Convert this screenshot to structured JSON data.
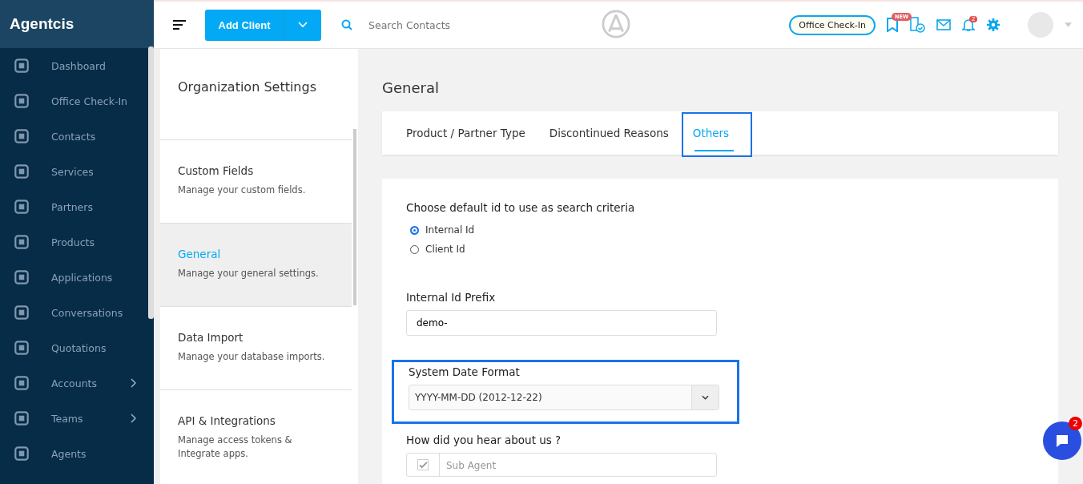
{
  "brand": "Agentcis",
  "sidebar": {
    "items": [
      {
        "label": "Dashboard",
        "has_submenu": false
      },
      {
        "label": "Office Check-In",
        "has_submenu": false
      },
      {
        "label": "Contacts",
        "has_submenu": false
      },
      {
        "label": "Services",
        "has_submenu": false
      },
      {
        "label": "Partners",
        "has_submenu": false
      },
      {
        "label": "Products",
        "has_submenu": false
      },
      {
        "label": "Applications",
        "has_submenu": false
      },
      {
        "label": "Conversations",
        "has_submenu": false
      },
      {
        "label": "Quotations",
        "has_submenu": false
      },
      {
        "label": "Accounts",
        "has_submenu": true
      },
      {
        "label": "Teams",
        "has_submenu": true
      },
      {
        "label": "Agents",
        "has_submenu": false
      }
    ]
  },
  "topbar": {
    "add_button": "Add Client",
    "search": {
      "placeholder": "Search Contacts"
    },
    "checkin_button": "Office Check-In",
    "new_badge": "NEW",
    "notification_count": "2"
  },
  "settings_nav": {
    "title": "Organization Settings",
    "items": [
      {
        "title": "Custom Fields",
        "description": "Manage your custom fields.",
        "selected": false
      },
      {
        "title": "General",
        "description": "Manage your general settings.",
        "selected": true
      },
      {
        "title": "Data Import",
        "description": "Manage your database imports.",
        "selected": false
      },
      {
        "title": "API & Integrations",
        "description": "Manage access tokens & Integrate apps.",
        "selected": false
      }
    ]
  },
  "page_title": "General",
  "tabs": [
    {
      "label": "Product / Partner Type",
      "selected": false,
      "highlighted": false
    },
    {
      "label": "Discontinued Reasons",
      "selected": false,
      "highlighted": false
    },
    {
      "label": "Others",
      "selected": true,
      "highlighted": true
    }
  ],
  "form": {
    "search_id": {
      "label": "Choose default id to use as search criteria",
      "options": [
        {
          "label": "Internal Id",
          "selected": true
        },
        {
          "label": "Client Id",
          "selected": false
        }
      ]
    },
    "prefix": {
      "label": "Internal Id Prefix",
      "value": "demo-"
    },
    "date_format": {
      "label": "System Date Format",
      "value": "YYYY-MM-DD (2012-12-22)",
      "highlighted": true
    },
    "hear_about": {
      "label": "How did you hear about us ?",
      "options": [
        {
          "label": "Sub Agent",
          "checked": true
        }
      ]
    }
  },
  "chat": {
    "unread": "2"
  }
}
